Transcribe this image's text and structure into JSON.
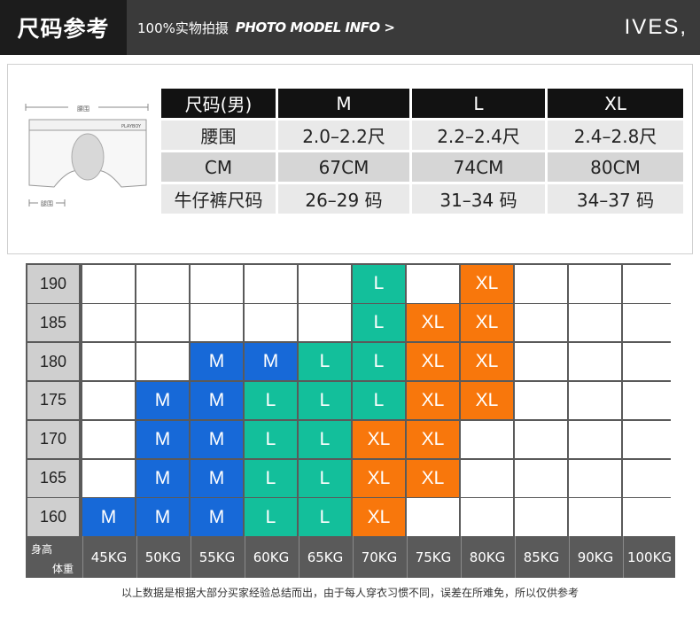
{
  "header": {
    "title": "尺码参考",
    "subtitle_cn": "100%实物拍摄",
    "subtitle_en": "PHOTO MODEL INFO >",
    "brand": "IVES,"
  },
  "diagram": {
    "waist_label": "腰围",
    "leg_label": "腿围",
    "brand_mark": "PLAYBOY"
  },
  "size_table": {
    "header": [
      "尺码(男)",
      "M",
      "L",
      "XL"
    ],
    "rows": [
      [
        "腰围",
        "2.0–2.2尺",
        "2.2–2.4尺",
        "2.4–2.8尺"
      ],
      [
        "CM",
        "67CM",
        "74CM",
        "80CM"
      ],
      [
        "牛仔裤尺码",
        "26–29 码",
        "31–34 码",
        "34–37 码"
      ]
    ]
  },
  "grid": {
    "heights": [
      "190",
      "185",
      "180",
      "175",
      "170",
      "165",
      "160"
    ],
    "weights": [
      "45KG",
      "50KG",
      "55KG",
      "60KG",
      "65KG",
      "70KG",
      "75KG",
      "80KG",
      "85KG",
      "90KG",
      "100KG"
    ],
    "corner_height": "身高",
    "corner_weight": "体重",
    "cells": [
      [
        "",
        "",
        "",
        "",
        "",
        "L",
        "",
        "XL",
        "",
        "",
        ""
      ],
      [
        "",
        "",
        "",
        "",
        "",
        "L",
        "XL",
        "XL",
        "",
        "",
        ""
      ],
      [
        "",
        "",
        "M",
        "M",
        "L",
        "L",
        "XL",
        "XL",
        "",
        "",
        ""
      ],
      [
        "",
        "M",
        "M",
        "L",
        "L",
        "L",
        "XL",
        "XL",
        "",
        "",
        ""
      ],
      [
        "",
        "M",
        "M",
        "L",
        "L",
        "XL",
        "XL",
        "",
        "",
        "",
        ""
      ],
      [
        "",
        "M",
        "M",
        "L",
        "L",
        "XL",
        "XL",
        "",
        "",
        "",
        ""
      ],
      [
        "M",
        "M",
        "M",
        "L",
        "L",
        "XL",
        "",
        "",
        "",
        "",
        ""
      ]
    ],
    "colors": {
      "M": "#1769d8",
      "L": "#13bf9b",
      "XL": "#f8770c"
    }
  },
  "footer": "以上数据是根据大部分买家经验总结而出，由于每人穿衣习惯不同，误差在所难免，所以仅供参考"
}
